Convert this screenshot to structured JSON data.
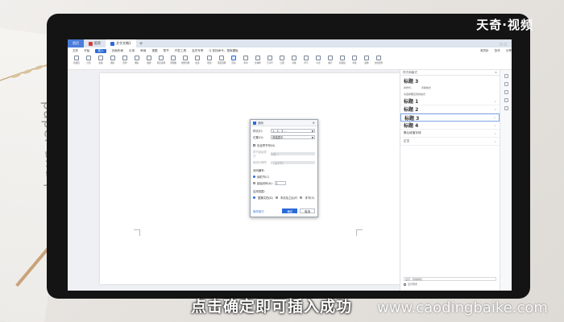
{
  "brand": {
    "name": "天奇·视频"
  },
  "caption": {
    "text": "点击确定即可插入成功",
    "watermark": "www.caodingbaike.com"
  },
  "background": {
    "notebook_text": "paper and pencil"
  },
  "tabs": [
    {
      "label": "首页"
    },
    {
      "label": "稻壳"
    },
    {
      "label": "文字文稿1"
    }
  ],
  "tab_add": "+",
  "tab_right": "▢ ▢",
  "menu": {
    "items": [
      "文件",
      "开始",
      "插入",
      "页面布局",
      "引用",
      "审阅",
      "视图",
      "章节",
      "开发工具",
      "会员专享",
      "Q 查找命令、搜索模板"
    ],
    "active_index": 2,
    "right": [
      "未同步",
      "协作",
      "分享"
    ]
  },
  "ribbon": {
    "buttons": [
      "新建页",
      "分页",
      "表格",
      "图片",
      "形状",
      "图标",
      "截屏",
      "稻壳资源",
      "流程图",
      "思维导图",
      "更多",
      "批注",
      "页眉页脚",
      "页码",
      "水印",
      "文本框",
      "艺术字",
      "日期",
      "对象",
      "符号",
      "公式",
      "编号",
      "超链接",
      "书签",
      "窗体",
      "文档部件"
    ],
    "selected_index": 13
  },
  "dialog": {
    "title": "页码",
    "close": "×",
    "style_label": "样式(F):",
    "style_value": "1，2，3 ...",
    "position_label": "位置(O):",
    "position_value": "底端居中",
    "include_chapter": "包含章节号(N)",
    "chapter_start_label": "章节起始样式",
    "chapter_sep_label": "使用分隔符",
    "chapter_start_value": "标题 1",
    "chapter_sep_value": "-（连字符）",
    "numbering_header": "页码编号：",
    "continue_label": "续前节(C)",
    "start_label": "起始页码(A):",
    "start_value": "1",
    "apply_header": "应用范围：",
    "apply_options": [
      "整篇文档(D)",
      "本页及之后(P)",
      "本节(S)"
    ],
    "tip": "操作技巧",
    "ok": "确定",
    "cancel": "取消"
  },
  "panel": {
    "title": "样式和格式",
    "close": "×",
    "current": "标题 3",
    "links": [
      "新样式...",
      "清除格式"
    ],
    "sub": "请选择要应用的格式",
    "styles": [
      {
        "name": "标题 1",
        "big": true
      },
      {
        "name": "标题 2",
        "big": true
      },
      {
        "name": "标题 3",
        "big": true
      },
      {
        "name": "标题 4",
        "big": true
      },
      {
        "name": "默认段落字体",
        "big": false
      },
      {
        "name": "正文",
        "big": false
      }
    ],
    "selected_index": 2,
    "bottom_label": "显示：有效样式",
    "bottom_check": "显示预览"
  },
  "rail_icons": [
    "style-icon",
    "select-icon",
    "tool-icon",
    "help-icon",
    "share-icon"
  ]
}
